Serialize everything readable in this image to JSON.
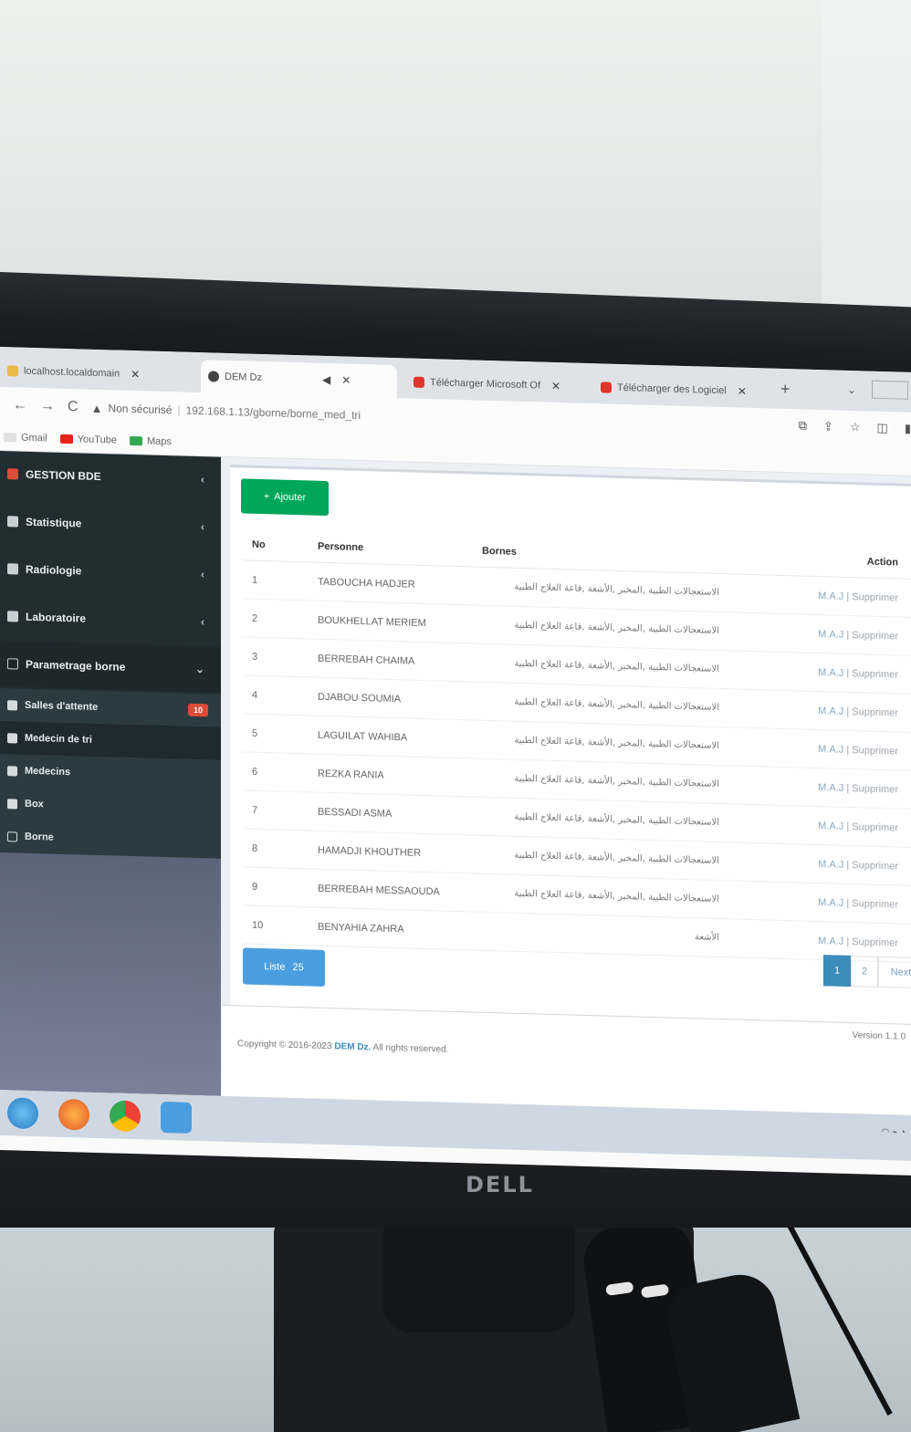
{
  "browser": {
    "tabs": [
      {
        "label": "localhost.localdomain",
        "active": false
      },
      {
        "label": "DEM Dz",
        "active": true
      },
      {
        "label": "Télécharger Microsoft Of",
        "active": false
      },
      {
        "label": "Télécharger des Logiciel",
        "active": false
      }
    ],
    "address": {
      "security": "Non sécurisé",
      "url": "192.168.1.13/gborne/borne_med_tri"
    },
    "bookmarks": [
      "Gmail",
      "YouTube",
      "Maps"
    ]
  },
  "sidebar": {
    "items": [
      {
        "label": "GESTION BDE"
      },
      {
        "label": "Statistique"
      },
      {
        "label": "Radiologie"
      },
      {
        "label": "Laboratoire"
      },
      {
        "label": "Parametrage borne"
      }
    ],
    "subitems": [
      {
        "label": "Salles d'attente",
        "badge": "10"
      },
      {
        "label": "Medecin de tri",
        "badge": ""
      },
      {
        "label": "Medecins",
        "badge": ""
      },
      {
        "label": "Box",
        "badge": ""
      },
      {
        "label": "Borne",
        "badge": ""
      }
    ]
  },
  "main": {
    "add_button": "Ajouter",
    "columns": {
      "no": "No",
      "personne": "Personne",
      "bornes": "Bornes",
      "action": "Action"
    },
    "rows": [
      {
        "no": "1",
        "personne": "TABOUCHA HADJER",
        "bornes": "الاستعجالات الطبية ,المخبر ,الأشعة ,قاعة العلاج الطبية",
        "action_edit": "M.A.J",
        "action_delete": "Supprimer"
      },
      {
        "no": "2",
        "personne": "BOUKHELLAT MERIEM",
        "bornes": "الاستعجالات الطبية ,المخبر ,الأشعة ,قاعة العلاج الطبية",
        "action_edit": "M.A.J",
        "action_delete": "Supprimer"
      },
      {
        "no": "3",
        "personne": "BERREBAH CHAIMA",
        "bornes": "الاستعجالات الطبية ,المخبر ,الأشعة ,قاعة العلاج الطبية",
        "action_edit": "M.A.J",
        "action_delete": "Supprimer"
      },
      {
        "no": "4",
        "personne": "DJABOU SOUMIA",
        "bornes": "الاستعجالات الطبية ,المخبر ,الأشعة ,قاعة العلاج الطبية",
        "action_edit": "M.A.J",
        "action_delete": "Supprimer"
      },
      {
        "no": "5",
        "personne": "LAGUILAT WAHIBA",
        "bornes": "الاستعجالات الطبية ,المخبر ,الأشعة ,قاعة العلاج الطبية",
        "action_edit": "M.A.J",
        "action_delete": "Supprimer"
      },
      {
        "no": "6",
        "personne": "REZKA RANIA",
        "bornes": "الاستعجالات الطبية ,المخبر ,الأشعة ,قاعة العلاج الطبية",
        "action_edit": "M.A.J",
        "action_delete": "Supprimer"
      },
      {
        "no": "7",
        "personne": "BESSADI ASMA",
        "bornes": "الاستعجالات الطبية ,المخبر ,الأشعة ,قاعة العلاج الطبية",
        "action_edit": "M.A.J",
        "action_delete": "Supprimer"
      },
      {
        "no": "8",
        "personne": "HAMADJI KHOUTHER",
        "bornes": "الاستعجالات الطبية ,المخبر ,الأشعة ,قاعة العلاج الطبية",
        "action_edit": "M.A.J",
        "action_delete": "Supprimer"
      },
      {
        "no": "9",
        "personne": "BERREBAH MESSAOUDA",
        "bornes": "الاستعجالات الطبية ,المخبر ,الأشعة ,قاعة العلاج الطبية",
        "action_edit": "M.A.J",
        "action_delete": "Supprimer"
      },
      {
        "no": "10",
        "personne": "BENYAHIA ZAHRA",
        "bornes": "الأشعة",
        "action_edit": "M.A.J",
        "action_delete": "Supprimer"
      }
    ],
    "show_label": "Liste",
    "show_count": "25",
    "pagination": {
      "current": "1",
      "next": "2",
      "more": "Next"
    }
  },
  "footer": {
    "copyright_prefix": "Copyright © 2016-2023 ",
    "company": "DEM Dz.",
    "copyright_suffix": " All rights reserved.",
    "version": "Version 1.1.0"
  },
  "monitor": {
    "brand": "DELL"
  }
}
